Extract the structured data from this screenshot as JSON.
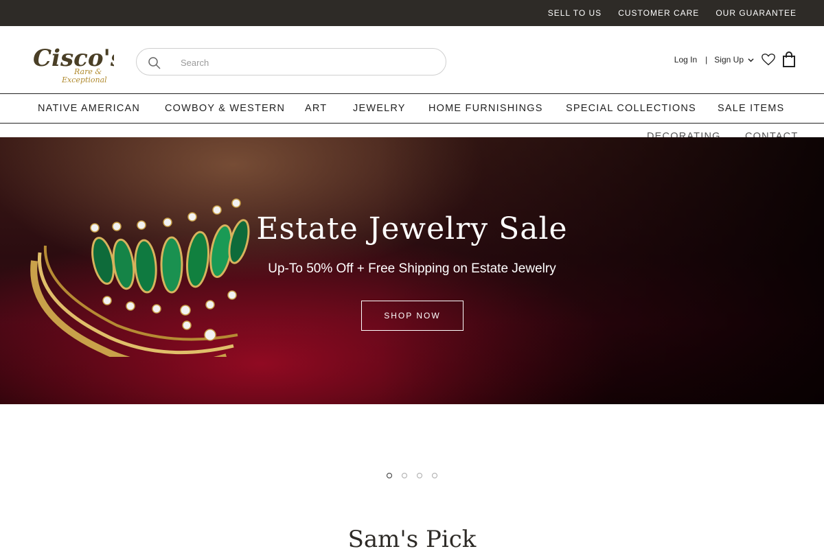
{
  "topbar": {
    "links": [
      "SELL TO US",
      "CUSTOMER CARE",
      "OUR GUARANTEE"
    ]
  },
  "brand": {
    "name": "CISCO'S",
    "tagline_1": "Rare &",
    "tagline_2": "Exceptional",
    "color": "#4a3f26",
    "accent": "#b08a2e"
  },
  "search": {
    "placeholder": "Search"
  },
  "account": {
    "login": "Log In",
    "separator": "|",
    "signup": "Sign Up"
  },
  "nav": {
    "items": [
      "NATIVE AMERICAN",
      "COWBOY & WESTERN",
      "ART",
      "JEWELRY",
      "HOME FURNISHINGS",
      "SPECIAL COLLECTIONS",
      "SALE ITEMS"
    ],
    "overflow_items": [
      "DECORATING",
      "CONTACT"
    ]
  },
  "hero": {
    "title": "Estate Jewelry Sale",
    "subtitle": "Up-To 50% Off + Free Shipping on Estate Jewelry",
    "button": "SHOP NOW",
    "slide_count": 4,
    "active_slide": 1
  },
  "section": {
    "title": "Sam's Pick"
  }
}
